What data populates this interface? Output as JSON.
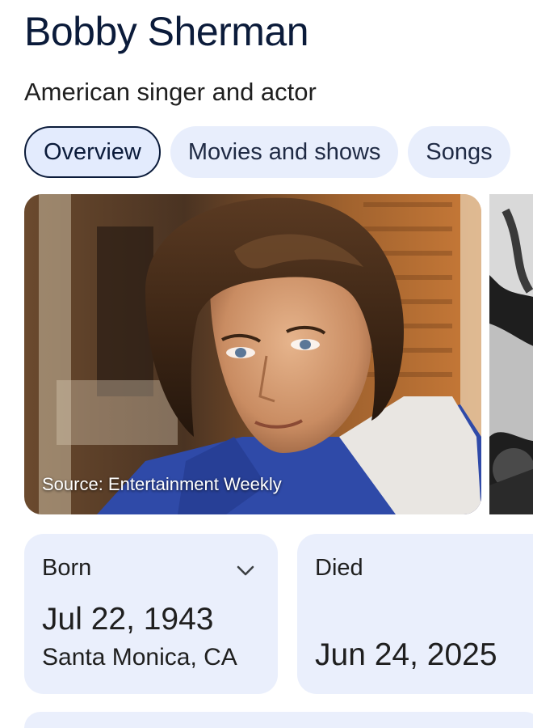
{
  "header": {
    "title": "Bobby Sherman",
    "subtitle": "American singer and actor"
  },
  "tabs": [
    {
      "label": "Overview",
      "active": true
    },
    {
      "label": "Movies and shows",
      "active": false
    },
    {
      "label": "Songs",
      "active": false
    }
  ],
  "gallery": {
    "source_label": "Source: Entertainment Weekly"
  },
  "facts": {
    "born": {
      "label": "Born",
      "date": "Jul 22, 1943",
      "place": "Santa Monica, CA"
    },
    "died": {
      "label": "Died",
      "date": "Jun 24, 2025"
    }
  },
  "colors": {
    "title": "#0b1b3a",
    "chip_bg": "#e8eefc",
    "card_bg": "#eaeffc"
  }
}
